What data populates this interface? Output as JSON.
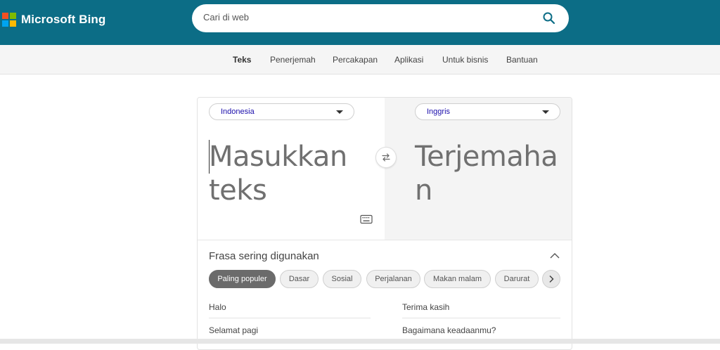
{
  "header": {
    "brand": "Microsoft Bing",
    "logo_colors": [
      "#f25022",
      "#7fba00",
      "#00a4ef",
      "#ffb900"
    ],
    "search_placeholder": "Cari di web",
    "bg_color": "#0c6d86"
  },
  "nav": {
    "items": [
      {
        "label": "Teks",
        "active": true
      },
      {
        "label": "Penerjemah",
        "active": false
      },
      {
        "label": "Percakapan",
        "active": false
      },
      {
        "label": "Aplikasi",
        "active": false
      },
      {
        "label": "Untuk bisnis",
        "active": false
      },
      {
        "label": "Bantuan",
        "active": false
      }
    ]
  },
  "translator": {
    "source_lang": "Indonesia",
    "target_lang": "Inggris",
    "source_line1": "Masukkan",
    "source_line2": "teks",
    "target_line1": "Terjemaha",
    "target_line2": "n"
  },
  "phrases": {
    "title": "Frasa sering digunakan",
    "categories": [
      "Paling populer",
      "Dasar",
      "Sosial",
      "Perjalanan",
      "Makan malam",
      "Darurat"
    ],
    "active_category": "Paling populer",
    "items": [
      "Halo",
      "Terima kasih",
      "Selamat pagi",
      "Bagaimana keadaanmu?"
    ]
  },
  "icons": {
    "search": "search-icon",
    "swap": "swap-icon",
    "keyboard": "keyboard-icon",
    "collapse": "chevron-up-icon",
    "next": "chevron-right-icon",
    "dropdown": "caret-down-icon"
  }
}
